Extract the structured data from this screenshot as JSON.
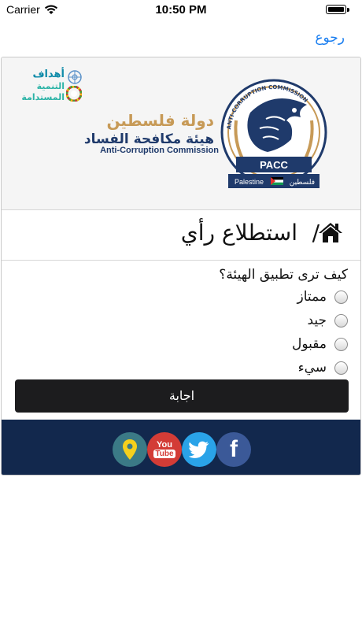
{
  "status_bar": {
    "carrier": "Carrier",
    "time": "10:50 PM"
  },
  "nav": {
    "back_label": "رجوع"
  },
  "header": {
    "sdg_line1": "أهداف",
    "sdg_line2": "التنمية",
    "sdg_line3": "المستدامة",
    "org_name_ar_1": "دولة فلسطين",
    "org_name_ar_2": "هيئة مكافحة الفساد",
    "org_name_en": "Anti-Corruption Commission",
    "emblem_ring": "ANTI-CORRUPTION COMMISSION",
    "emblem_abbr": "PACC",
    "emblem_country_en": "Palestine",
    "emblem_country_ar": "فلسطين"
  },
  "page": {
    "title": "استطلاع رأي",
    "separator": "/"
  },
  "poll": {
    "question": "كيف ترى تطبيق الهيئة؟",
    "options": [
      "ممتاز",
      "جيد",
      "مقبول",
      "سيء"
    ],
    "submit_label": "اجابة"
  },
  "footer": {
    "social": [
      "location-icon",
      "youtube-icon",
      "twitter-icon",
      "facebook-icon"
    ],
    "youtube_you": "You",
    "youtube_tube": "Tube",
    "facebook_glyph": "f"
  },
  "colors": {
    "link": "#1a7ef0",
    "footer_bg": "#12284d",
    "submit_bg": "#1c1c1e",
    "gold": "#c79a57",
    "navy": "#1f3a6b"
  }
}
